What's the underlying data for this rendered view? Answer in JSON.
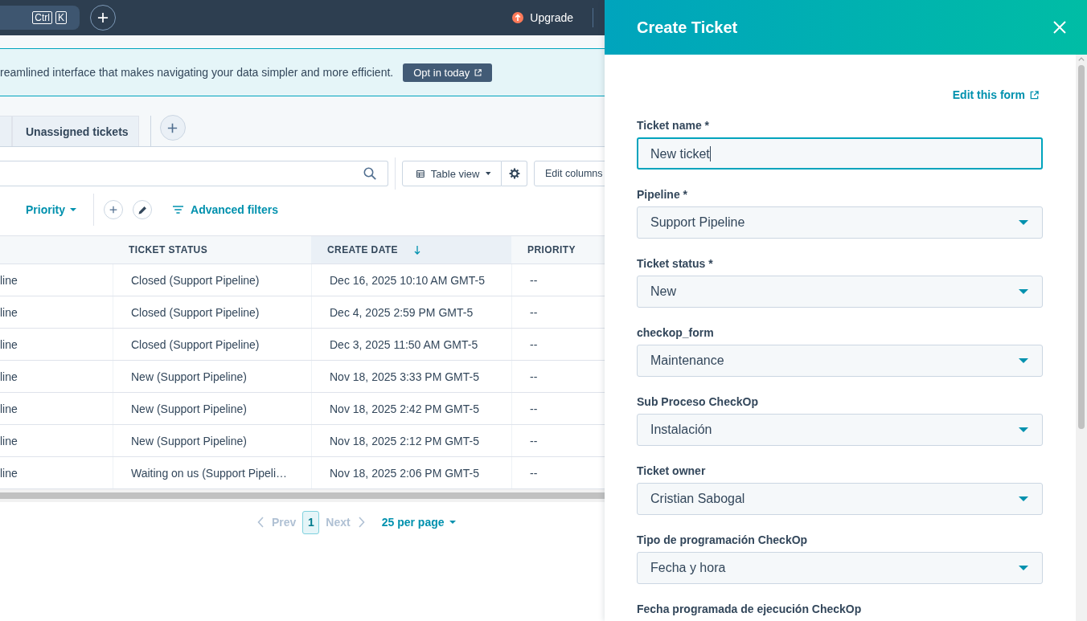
{
  "top_bar": {
    "search": {
      "shortcut_keys": [
        "Ctrl",
        "K"
      ]
    },
    "upgrade": "Upgrade"
  },
  "banner": {
    "text": "reamlined interface that makes navigating your data simpler and more efficient.",
    "button": "Opt in today"
  },
  "view_tabs": [
    {
      "selected": false
    },
    {
      "label": "Unassigned tickets",
      "selected": false
    }
  ],
  "toolbar": {
    "view_button": "Table view",
    "edit_columns": "Edit columns"
  },
  "filters": {
    "priority": "Priority",
    "advanced": "Advanced filters"
  },
  "table": {
    "columns": [
      {
        "sorted": false
      },
      {
        "label": "TICKET STATUS",
        "sorted": false
      },
      {
        "label": "CREATE DATE",
        "sorted": true
      },
      {
        "label": "PRIORITY",
        "sorted": false
      }
    ],
    "rows": [
      {
        "cells": [
          "line",
          "Closed (Support Pipeline)",
          "Dec 16, 2025 10:10 AM GMT-5",
          "--"
        ]
      },
      {
        "cells": [
          "line",
          "Closed (Support Pipeline)",
          "Dec 4, 2025 2:59 PM GMT-5",
          "--"
        ]
      },
      {
        "cells": [
          "line",
          "Closed (Support Pipeline)",
          "Dec 3, 2025 11:50 AM GMT-5",
          "--"
        ]
      },
      {
        "cells": [
          "line",
          "New (Support Pipeline)",
          "Nov 18, 2025 3:33 PM GMT-5",
          "--"
        ]
      },
      {
        "cells": [
          "line",
          "New (Support Pipeline)",
          "Nov 18, 2025 2:42 PM GMT-5",
          "--"
        ]
      },
      {
        "cells": [
          "line",
          "New (Support Pipeline)",
          "Nov 18, 2025 2:12 PM GMT-5",
          "--"
        ]
      },
      {
        "cells": [
          "line",
          "Waiting on us (Support Pipeli…",
          "Nov 18, 2025 2:06 PM GMT-5",
          "--"
        ]
      }
    ]
  },
  "pagination": {
    "prev": {
      "label": "Prev",
      "disabled": true
    },
    "pages": [
      {
        "label": "1",
        "selected": true
      }
    ],
    "next": {
      "label": "Next",
      "disabled": true
    },
    "per_page": "25 per page"
  },
  "drawer": {
    "title": "Create Ticket",
    "edit_form_link": "Edit this form",
    "fields": [
      {
        "kind": "text",
        "label": "Ticket name *",
        "value": "New ticket",
        "focused": true
      },
      {
        "kind": "select",
        "label": "Pipeline *",
        "value": "Support Pipeline"
      },
      {
        "kind": "select",
        "label": "Ticket status *",
        "value": "New"
      },
      {
        "kind": "select",
        "label": "checkop_form",
        "value": "Maintenance"
      },
      {
        "kind": "select",
        "label": "Sub Proceso CheckOp",
        "value": "Instalación"
      },
      {
        "kind": "select",
        "label": "Ticket owner",
        "value": "Cristian Sabogal"
      },
      {
        "kind": "select",
        "label": "Tipo de programación CheckOp",
        "value": "Fecha y hora"
      },
      {
        "kind": "label_only",
        "label": "Fecha programada de ejecución CheckOp"
      }
    ]
  }
}
